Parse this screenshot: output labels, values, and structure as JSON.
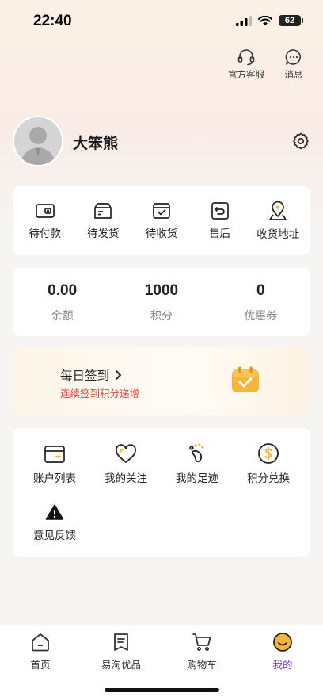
{
  "status_bar": {
    "time": "22:40",
    "battery": "62"
  },
  "header": {
    "customer_service_label": "官方客服",
    "messages_label": "消息"
  },
  "profile": {
    "username": "大笨熊"
  },
  "orders": [
    {
      "label": "待付款",
      "icon": "wallet-icon"
    },
    {
      "label": "待发货",
      "icon": "box-icon"
    },
    {
      "label": "待收货",
      "icon": "package-check-icon"
    },
    {
      "label": "售后",
      "icon": "return-icon"
    },
    {
      "label": "收货地址",
      "icon": "location-pin-icon"
    }
  ],
  "assets": [
    {
      "value": "0.00",
      "label": "余额"
    },
    {
      "value": "1000",
      "label": "积分"
    },
    {
      "value": "0",
      "label": "优惠券"
    }
  ],
  "checkin": {
    "title": "每日签到",
    "subtitle": "连续签到积分递增",
    "accent": "#f5b638"
  },
  "tools": [
    {
      "label": "账户列表",
      "icon": "card-icon"
    },
    {
      "label": "我的关注",
      "icon": "heart-icon"
    },
    {
      "label": "我的足迹",
      "icon": "footprint-icon"
    },
    {
      "label": "积分兑换",
      "icon": "dollar-coin-icon"
    },
    {
      "label": "意见反馈",
      "icon": "warning-icon"
    }
  ],
  "tabbar": [
    {
      "label": "首页",
      "icon": "home-icon"
    },
    {
      "label": "易淘优品",
      "icon": "list-icon"
    },
    {
      "label": "购物车",
      "icon": "cart-icon"
    },
    {
      "label": "我的",
      "icon": "smile-icon",
      "active": true
    }
  ],
  "colors": {
    "active_tab": "#8a3fd1",
    "checkin_subtitle": "#e0413b"
  }
}
